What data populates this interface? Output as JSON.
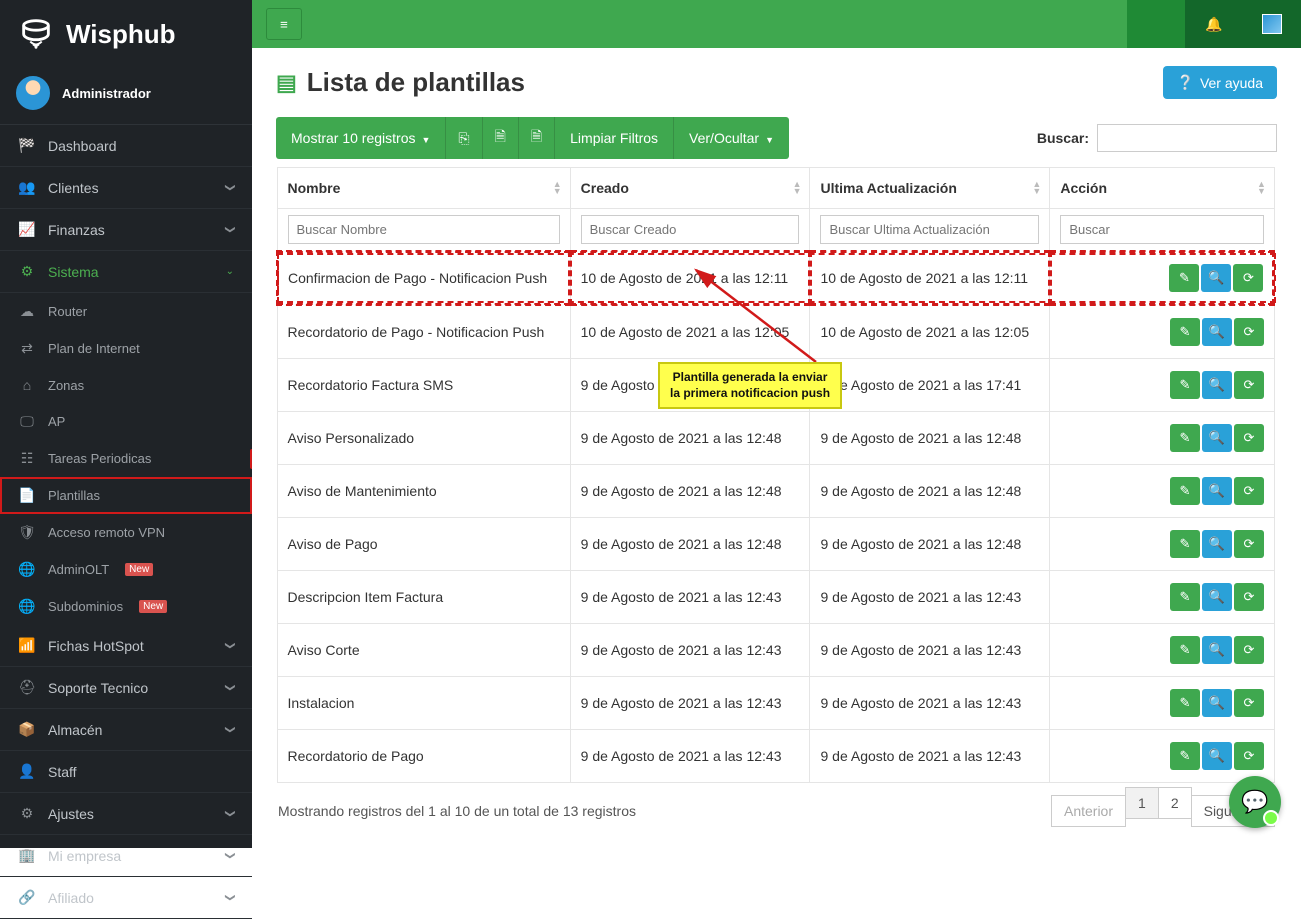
{
  "brand": {
    "name": "Wisphub"
  },
  "user": {
    "role": "Administrador"
  },
  "sidebar": {
    "items": [
      {
        "icon": "gauge",
        "label": "Dashboard"
      },
      {
        "icon": "users",
        "label": "Clientes",
        "chev": true
      },
      {
        "icon": "chart",
        "label": "Finanzas",
        "chev": true
      },
      {
        "icon": "sitemap",
        "label": "Sistema",
        "chev": true,
        "active": true
      }
    ],
    "sistema_sub": [
      {
        "icon": "cloud",
        "label": "Router"
      },
      {
        "icon": "exchange",
        "label": "Plan de Internet"
      },
      {
        "icon": "home",
        "label": "Zonas"
      },
      {
        "icon": "screen",
        "label": "AP"
      },
      {
        "icon": "list",
        "label": "Tareas Periodicas",
        "annot_badge": "1"
      },
      {
        "icon": "tasks",
        "label": "Plantillas",
        "selected": true
      },
      {
        "icon": "shield",
        "label": "Acceso remoto VPN"
      },
      {
        "icon": "globe",
        "label": "AdminOLT",
        "badge": "New"
      },
      {
        "icon": "globe",
        "label": "Subdominios",
        "badge": "New"
      }
    ],
    "rest": [
      {
        "icon": "wifi",
        "label": "Fichas HotSpot",
        "chev": true
      },
      {
        "icon": "lifering",
        "label": "Soporte Tecnico",
        "chev": true
      },
      {
        "icon": "archive",
        "label": "Almacén",
        "chev": true
      },
      {
        "icon": "person",
        "label": "Staff"
      },
      {
        "icon": "gear",
        "label": "Ajustes",
        "chev": true
      },
      {
        "icon": "building",
        "label": "Mi empresa",
        "chev": true
      },
      {
        "icon": "link",
        "label": "Afiliado",
        "chev": true
      }
    ]
  },
  "page": {
    "title": "Lista de plantillas",
    "help_label": "Ver ayuda"
  },
  "toolbar": {
    "show_records": "Mostrar 10 registros",
    "clear_filters": "Limpiar Filtros",
    "toggle_cols": "Ver/Ocultar"
  },
  "search": {
    "label": "Buscar:",
    "value": ""
  },
  "table": {
    "headers": {
      "name": "Nombre",
      "created": "Creado",
      "updated": "Ultima Actualización",
      "action": "Acción"
    },
    "filter_placeholders": {
      "name": "Buscar Nombre",
      "created": "Buscar Creado",
      "updated": "Buscar Ultima Actualización",
      "action": "Buscar"
    },
    "rows": [
      {
        "name": "Confirmacion de Pago - Notificacion Push",
        "created": "10 de Agosto de 2021 a las 12:11",
        "updated": "10 de Agosto de 2021 a las 12:11",
        "highlight": true
      },
      {
        "name": "Recordatorio de Pago - Notificacion Push",
        "created": "10 de Agosto de 2021 a las 12:05",
        "updated": "10 de Agosto de 2021 a las 12:05"
      },
      {
        "name": "Recordatorio Factura SMS",
        "created": "9 de Agosto de 2021 a las 17:41",
        "updated": "9 de Agosto de 2021 a las 17:41"
      },
      {
        "name": "Aviso Personalizado",
        "created": "9 de Agosto de 2021 a las 12:48",
        "updated": "9 de Agosto de 2021 a las 12:48"
      },
      {
        "name": "Aviso de Mantenimiento",
        "created": "9 de Agosto de 2021 a las 12:48",
        "updated": "9 de Agosto de 2021 a las 12:48"
      },
      {
        "name": "Aviso de Pago",
        "created": "9 de Agosto de 2021 a las 12:48",
        "updated": "9 de Agosto de 2021 a las 12:48"
      },
      {
        "name": "Descripcion Item Factura",
        "created": "9 de Agosto de 2021 a las 12:43",
        "updated": "9 de Agosto de 2021 a las 12:43"
      },
      {
        "name": "Aviso Corte",
        "created": "9 de Agosto de 2021 a las 12:43",
        "updated": "9 de Agosto de 2021 a las 12:43"
      },
      {
        "name": "Instalacion",
        "created": "9 de Agosto de 2021 a las 12:43",
        "updated": "9 de Agosto de 2021 a las 12:43"
      },
      {
        "name": "Recordatorio de Pago",
        "created": "9 de Agosto de 2021 a las 12:43",
        "updated": "9 de Agosto de 2021 a las 12:43"
      }
    ]
  },
  "footer": {
    "info": "Mostrando registros del 1 al 10 de un total de 13 registros",
    "prev": "Anterior",
    "next": "Siguiente",
    "pages": [
      "1",
      "2"
    ],
    "active_page": "1"
  },
  "annotation": {
    "line1": "Plantilla generada la enviar",
    "line2": "la primera notificacion push"
  }
}
